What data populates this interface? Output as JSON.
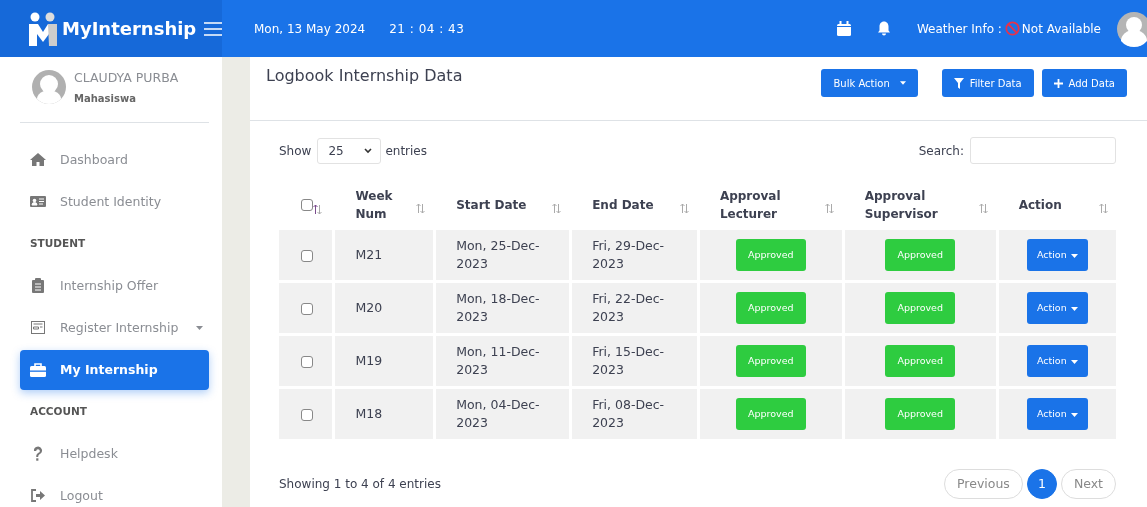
{
  "header": {
    "brand": "MyInternship",
    "date": "Mon, 13 May 2024",
    "time": "21 : 04 : 43",
    "weather_label": "Weather Info :",
    "weather_value": "Not Available"
  },
  "user": {
    "name": "CLAUDYA PURBA",
    "role": "Mahasiswa"
  },
  "sidebar": {
    "items": [
      {
        "kind": "link",
        "label": "Dashboard",
        "selected": false,
        "dropdown": false
      },
      {
        "kind": "link",
        "label": "Student Identity",
        "selected": false,
        "dropdown": false
      },
      {
        "kind": "section",
        "label": "STUDENT"
      },
      {
        "kind": "link",
        "label": "Internship Offer",
        "selected": false,
        "dropdown": false
      },
      {
        "kind": "link",
        "label": "Register Internship",
        "selected": false,
        "dropdown": true
      },
      {
        "kind": "link",
        "label": "My Internship",
        "selected": true,
        "dropdown": false
      },
      {
        "kind": "section",
        "label": "ACCOUNT"
      },
      {
        "kind": "link",
        "label": "Helpdesk",
        "selected": false,
        "dropdown": false
      },
      {
        "kind": "link",
        "label": "Logout",
        "selected": false,
        "dropdown": false
      }
    ]
  },
  "page": {
    "title": "Logbook Internship Data",
    "buttons": [
      {
        "kind": "dropdown",
        "label": "Bulk Action"
      },
      {
        "kind": "filter",
        "label": "Filter Data"
      },
      {
        "kind": "add",
        "label": "Add Data"
      }
    ]
  },
  "table": {
    "show_label": "Show",
    "page_length": "25",
    "entries_label": "entries",
    "search_label": "Search:",
    "select_all_checked": false,
    "columns": [
      {
        "label": "Week Num"
      },
      {
        "label": "Start Date"
      },
      {
        "label": "End Date"
      },
      {
        "label": "Approval Lecturer"
      },
      {
        "label": "Approval Supervisor"
      },
      {
        "label": "Action"
      }
    ],
    "rows": [
      {
        "checked": false,
        "week": "M21",
        "start": "Mon, 25-Dec-2023",
        "end": "Fri, 29-Dec-2023",
        "lecturer": "Approved",
        "supervisor": "Approved",
        "action": "Action"
      },
      {
        "checked": false,
        "week": "M20",
        "start": "Mon, 18-Dec-2023",
        "end": "Fri, 22-Dec-2023",
        "lecturer": "Approved",
        "supervisor": "Approved",
        "action": "Action"
      },
      {
        "checked": false,
        "week": "M19",
        "start": "Mon, 11-Dec-2023",
        "end": "Fri, 15-Dec-2023",
        "lecturer": "Approved",
        "supervisor": "Approved",
        "action": "Action"
      },
      {
        "checked": false,
        "week": "M18",
        "start": "Mon, 04-Dec-2023",
        "end": "Fri, 08-Dec-2023",
        "lecturer": "Approved",
        "supervisor": "Approved",
        "action": "Action"
      }
    ],
    "info": "Showing 1 to 4 of 4 entries",
    "pagination": [
      {
        "label": "Previous",
        "selected": false
      },
      {
        "label": "1",
        "selected": true
      },
      {
        "label": "Next",
        "selected": false
      }
    ]
  }
}
